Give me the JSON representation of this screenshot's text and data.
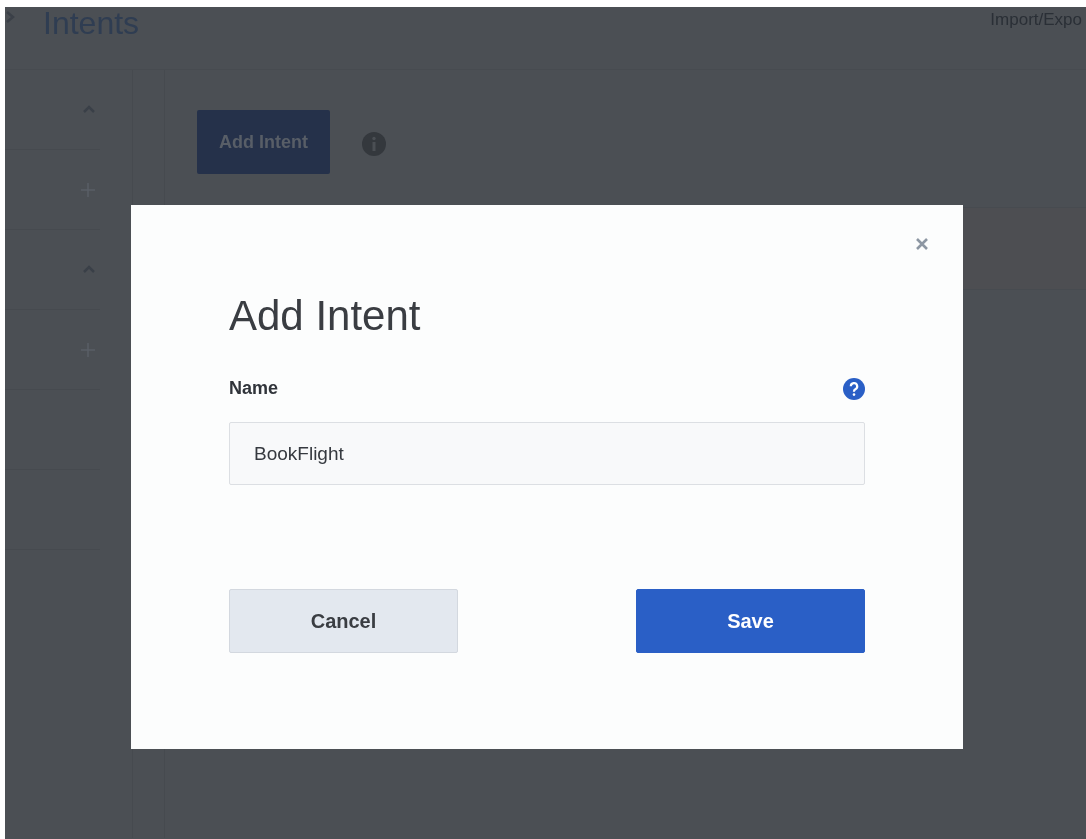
{
  "page": {
    "title": "Intents",
    "header_link": "Import/Expo",
    "add_button": "Add Intent"
  },
  "dialog": {
    "title": "Add Intent",
    "field_label": "Name",
    "field_value": "BookFlight",
    "buttons": [
      {
        "label": "Cancel",
        "kind": "secondary"
      },
      {
        "label": "Save",
        "kind": "primary"
      }
    ]
  }
}
